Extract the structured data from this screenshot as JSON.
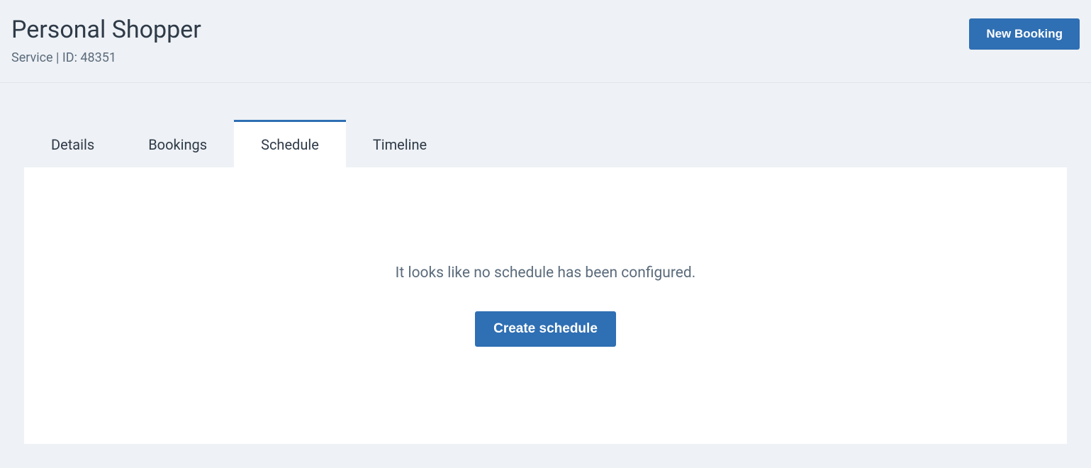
{
  "header": {
    "title": "Personal Shopper",
    "subtitle": "Service | ID: 48351",
    "new_booking_label": "New Booking"
  },
  "tabs": {
    "details": "Details",
    "bookings": "Bookings",
    "schedule": "Schedule",
    "timeline": "Timeline"
  },
  "panel": {
    "empty_message": "It looks like no schedule has been configured.",
    "create_label": "Create schedule"
  }
}
